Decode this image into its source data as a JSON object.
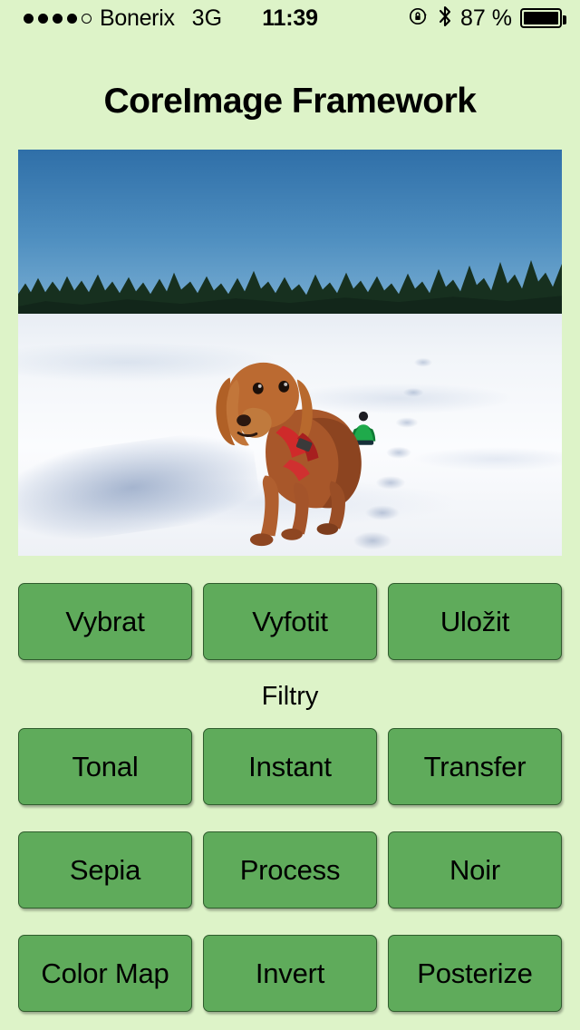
{
  "status_bar": {
    "signal_dots_filled": 4,
    "signal_dots_total": 5,
    "carrier": "Bonerix",
    "network": "3G",
    "time": "11:39",
    "rotation_lock_icon": "rotation-lock-icon",
    "bluetooth_icon": "bluetooth-icon",
    "battery_percent": "87 %",
    "battery_icon": "battery-full-icon"
  },
  "header": {
    "title": "CoreImage Framework"
  },
  "photo": {
    "alt": "Golden cocker spaniel with red harness walking on a snowy field, person in green jacket crouching in background, conifer treeline and blue sky"
  },
  "actions": {
    "buttons": [
      {
        "label": "Vybrat",
        "name": "pick-image-button"
      },
      {
        "label": "Vyfotit",
        "name": "take-photo-button"
      },
      {
        "label": "Uložit",
        "name": "save-image-button"
      }
    ]
  },
  "filters": {
    "section_label": "Filtry",
    "rows": [
      [
        {
          "label": "Tonal",
          "name": "filter-tonal-button"
        },
        {
          "label": "Instant",
          "name": "filter-instant-button"
        },
        {
          "label": "Transfer",
          "name": "filter-transfer-button"
        }
      ],
      [
        {
          "label": "Sepia",
          "name": "filter-sepia-button"
        },
        {
          "label": "Process",
          "name": "filter-process-button"
        },
        {
          "label": "Noir",
          "name": "filter-noir-button"
        }
      ],
      [
        {
          "label": "Color Map",
          "name": "filter-color-map-button"
        },
        {
          "label": "Invert",
          "name": "filter-invert-button"
        },
        {
          "label": "Posterize",
          "name": "filter-posterize-button"
        }
      ]
    ]
  },
  "colors": {
    "background": "#ddf3c8",
    "button_fill": "#5fab5b",
    "button_border": "#2f5c2d",
    "text": "#000000"
  }
}
